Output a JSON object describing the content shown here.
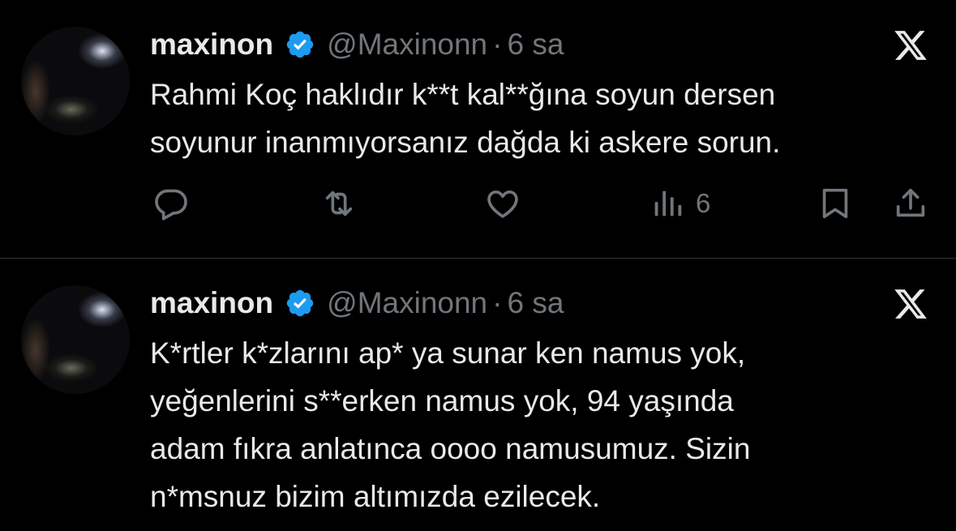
{
  "tweets": [
    {
      "author_name": "maxinon",
      "handle": "@Maxinonn",
      "separator": "·",
      "time": "6 sa",
      "text": "Rahmi Koç haklıdır k**t kal**ğına soyun dersen\nsoyunur inanmıyorsanız dağda ki askere sorun.",
      "views": "6"
    },
    {
      "author_name": "maxinon",
      "handle": "@Maxinonn",
      "separator": "·",
      "time": "6 sa",
      "text": "K*rtler k*zlarını ap* ya sunar ken namus yok,\nyeğenlerini s**erken namus yok, 94 yaşında\nadam fıkra anlatınca oooo namusumuz. Sizin\nn*msnuz bizim altımızda ezilecek."
    }
  ],
  "icons": {
    "verified": "verified-badge-icon",
    "brand": "x-logo-icon",
    "reply": "reply-icon",
    "retweet": "retweet-icon",
    "like": "like-icon",
    "views": "views-icon",
    "bookmark": "bookmark-icon",
    "share": "share-icon"
  },
  "colors": {
    "background": "#000000",
    "text": "#e7e9ea",
    "muted": "#71767b",
    "verified": "#1d9bf0",
    "divider": "#2f3336"
  }
}
